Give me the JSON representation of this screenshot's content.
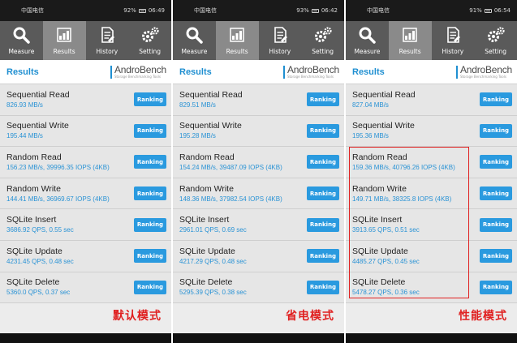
{
  "colors": {
    "accent": "#2a9adf",
    "nav_bg": "#5a5a5a",
    "nav_active": "#8a8a8a",
    "mode_label": "#e02020",
    "highlight_border": "#e02020"
  },
  "nav": [
    {
      "label": "Measure",
      "icon": "magnifier-icon"
    },
    {
      "label": "Results",
      "icon": "chart-icon",
      "active": true
    },
    {
      "label": "History",
      "icon": "document-icon"
    },
    {
      "label": "Setting",
      "icon": "gear-icon"
    }
  ],
  "header": {
    "title": "Results",
    "brand": "AndroBench",
    "tagline": "Storage Benchmarking Tools"
  },
  "ranking_label": "Ranking",
  "phones": [
    {
      "status": {
        "carrier": "中国电信",
        "battery": "92%",
        "time": "06:49"
      },
      "mode_label": "默认模式",
      "results": [
        {
          "name": "Sequential Read",
          "value": "826.93 MB/s"
        },
        {
          "name": "Sequential Write",
          "value": "195.44 MB/s"
        },
        {
          "name": "Random Read",
          "value": "156.23 MB/s, 39996.35 IOPS (4KB)"
        },
        {
          "name": "Random Write",
          "value": "144.41 MB/s, 36969.67 IOPS (4KB)"
        },
        {
          "name": "SQLite Insert",
          "value": "3686.92 QPS, 0.55 sec"
        },
        {
          "name": "SQLite Update",
          "value": "4231.45 QPS, 0.48 sec"
        },
        {
          "name": "SQLite Delete",
          "value": "5360.0 QPS, 0.37 sec"
        }
      ]
    },
    {
      "status": {
        "carrier": "中国电信",
        "battery": "93%",
        "time": "06:42"
      },
      "mode_label": "省电模式",
      "results": [
        {
          "name": "Sequential Read",
          "value": "829.51 MB/s"
        },
        {
          "name": "Sequential Write",
          "value": "195.28 MB/s"
        },
        {
          "name": "Random Read",
          "value": "154.24 MB/s, 39487.09 IOPS (4KB)"
        },
        {
          "name": "Random Write",
          "value": "148.36 MB/s, 37982.54 IOPS (4KB)"
        },
        {
          "name": "SQLite Insert",
          "value": "2961.01 QPS, 0.69 sec"
        },
        {
          "name": "SQLite Update",
          "value": "4217.29 QPS, 0.48 sec"
        },
        {
          "name": "SQLite Delete",
          "value": "5295.39 QPS, 0.38 sec"
        }
      ]
    },
    {
      "status": {
        "carrier": "中国电信",
        "battery": "91%",
        "time": "06:54"
      },
      "mode_label": "性能模式",
      "results": [
        {
          "name": "Sequential Read",
          "value": "827.04 MB/s"
        },
        {
          "name": "Sequential Write",
          "value": "195.36 MB/s"
        },
        {
          "name": "Random Read",
          "value": "159.36 MB/s, 40796.26 IOPS (4KB)"
        },
        {
          "name": "Random Write",
          "value": "149.71 MB/s, 38325.8 IOPS (4KB)"
        },
        {
          "name": "SQLite Insert",
          "value": "3913.65 QPS, 0.51 sec"
        },
        {
          "name": "SQLite Update",
          "value": "4485.27 QPS, 0.45 sec"
        },
        {
          "name": "SQLite Delete",
          "value": "5478.27 QPS, 0.36 sec"
        }
      ]
    }
  ]
}
